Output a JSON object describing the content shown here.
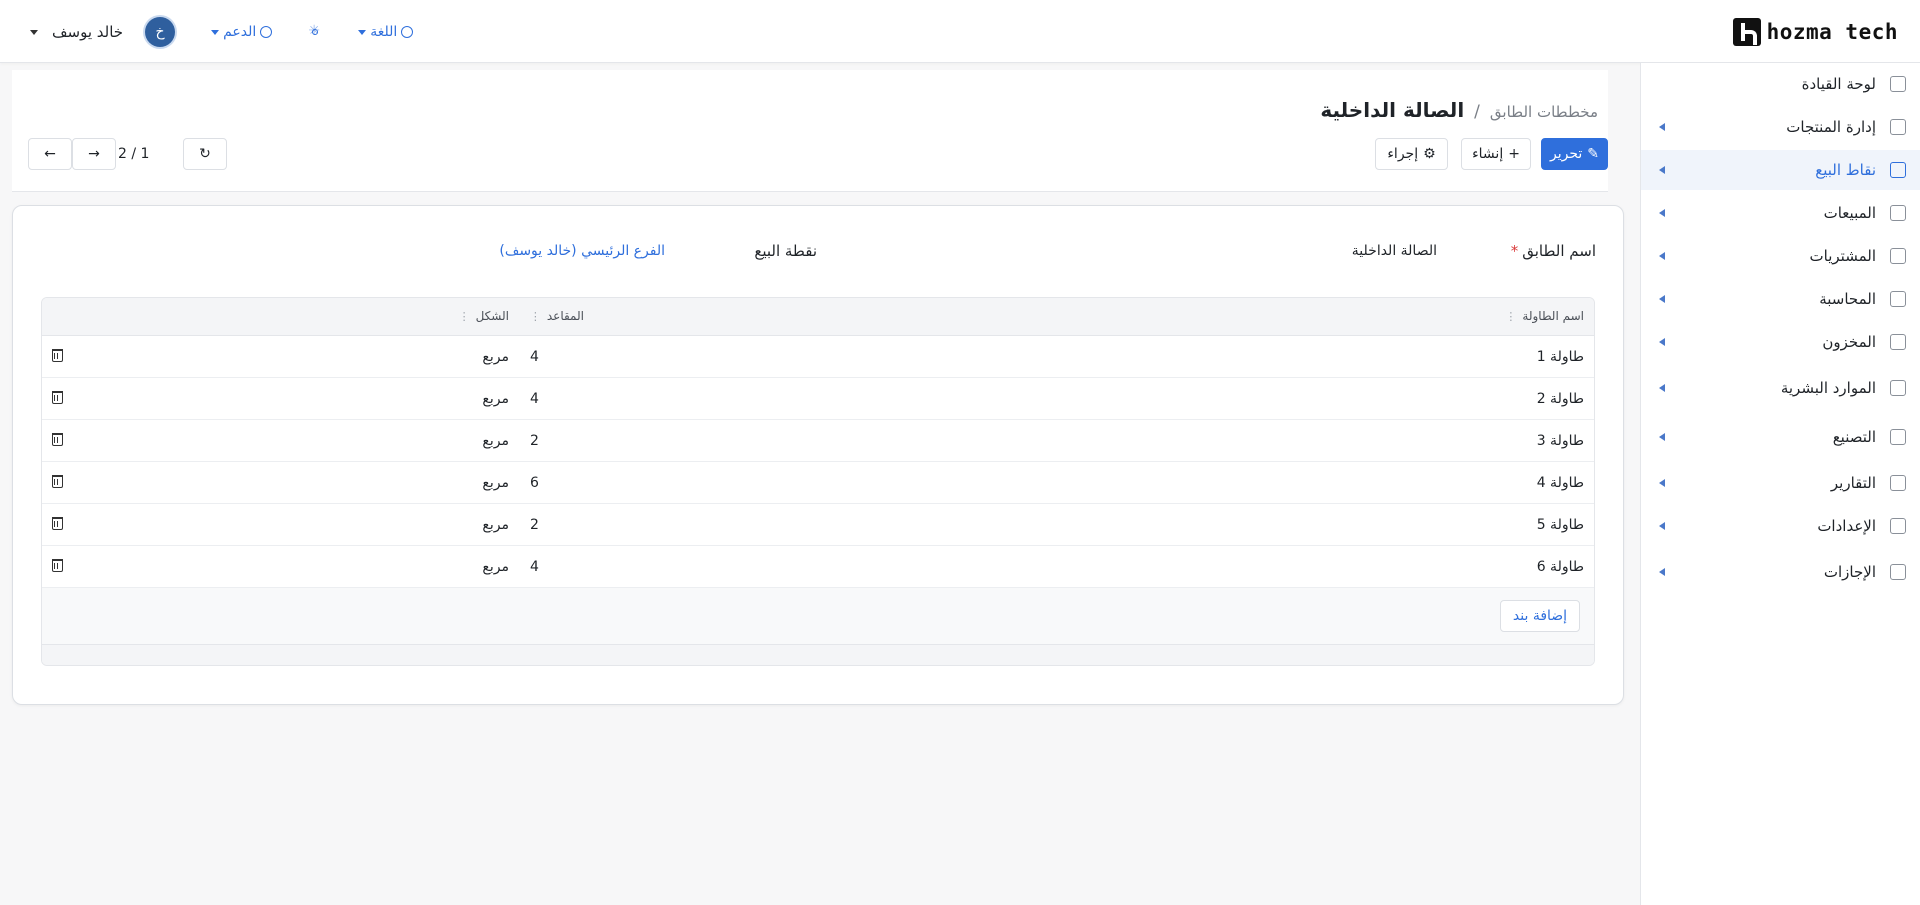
{
  "brand": {
    "name": "hozma tech"
  },
  "topbar": {
    "user_name": "خالد يوسف",
    "avatar_initial": "خ",
    "support_label": "الدعم",
    "language_label": "اللغة"
  },
  "sidebar": {
    "items": [
      {
        "label": "لوحة القيادة",
        "icon": "dashboard-icon",
        "has_children": false,
        "active": false
      },
      {
        "label": "إدارة المنتجات",
        "icon": "tag-icon",
        "has_children": true,
        "active": false
      },
      {
        "label": "نقاط البيع",
        "icon": "store-icon",
        "has_children": true,
        "active": true
      },
      {
        "label": "المبيعات",
        "icon": "chart-line-icon",
        "has_children": true,
        "active": false
      },
      {
        "label": "المشتريات",
        "icon": "wallet-icon",
        "has_children": true,
        "active": false
      },
      {
        "label": "المحاسبة",
        "icon": "ledger-icon",
        "has_children": true,
        "active": false
      },
      {
        "label": "المخزون",
        "icon": "box-icon",
        "has_children": true,
        "active": false
      },
      {
        "label": "الموارد البشرية",
        "icon": "document-icon",
        "has_children": true,
        "active": false
      },
      {
        "label": "التصنيع",
        "icon": "document-icon",
        "has_children": true,
        "active": false
      },
      {
        "label": "التقارير",
        "icon": "report-icon",
        "has_children": true,
        "active": false
      },
      {
        "label": "الإعدادات",
        "icon": "gear-icon",
        "has_children": true,
        "active": false
      },
      {
        "label": "الإجازات",
        "icon": "document-icon",
        "has_children": true,
        "active": false
      }
    ]
  },
  "header": {
    "breadcrumb_parent": "مخططات الطابق",
    "separator": "/",
    "title": "الصالة الداخلية",
    "edit_label": "تحرير",
    "create_label": "إنشاء",
    "action_label": "إجراء",
    "pager": "2 / 1"
  },
  "form": {
    "floor_name_label": "اسم الطابق",
    "floor_name_value": "الصالة الداخلية",
    "pos_label": "نقطة البيع",
    "pos_value": "الفرع الرئيسي (خالد يوسف)"
  },
  "table": {
    "columns": {
      "name": "اسم الطاولة",
      "seats": "المقاعد",
      "shape": "الشكل"
    },
    "rows": [
      {
        "name": "طاولة 1",
        "seats": "4",
        "shape": "مربع"
      },
      {
        "name": "طاولة 2",
        "seats": "4",
        "shape": "مربع"
      },
      {
        "name": "طاولة 3",
        "seats": "2",
        "shape": "مربع"
      },
      {
        "name": "طاولة 4",
        "seats": "6",
        "shape": "مربع"
      },
      {
        "name": "طاولة 5",
        "seats": "2",
        "shape": "مربع"
      },
      {
        "name": "طاولة 6",
        "seats": "4",
        "shape": "مربع"
      }
    ],
    "add_item_label": "إضافة بند"
  },
  "colors": {
    "accent": "#2f6fdc",
    "avatar": "#2f5f9e",
    "required": "#d93b3b"
  }
}
